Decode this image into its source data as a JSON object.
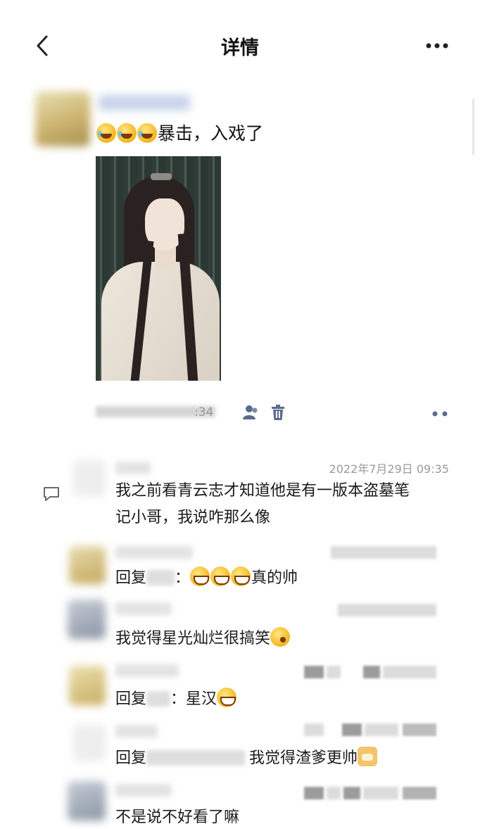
{
  "nav": {
    "title": "详情",
    "back_icon": "chevron-left-icon",
    "more_icon": "more-dots-icon"
  },
  "post": {
    "emojis": [
      "laugh-cry-emoji",
      "laugh-cry-emoji",
      "laugh-cry-emoji"
    ],
    "text": "暴击，入戏了",
    "photo_description": "costume drama character with long hair",
    "time_partial": ":34",
    "icons": [
      "friend-visibility-icon",
      "trash-icon",
      "comment-action-icon"
    ]
  },
  "comments": [
    {
      "time": "2022年7月29日 09:35",
      "line1": "我之前看青云志才知道他是有一版本盗墓笔",
      "line2": "记小哥，我说咋那么像"
    },
    {
      "prefix": "回复",
      "suffix": "：",
      "text": "真的帅",
      "emojis": [
        "grin-emoji",
        "grin-emoji",
        "grin-emoji"
      ]
    },
    {
      "text": "我觉得星光灿烂很搞笑",
      "emoji": "wink-emoji"
    },
    {
      "prefix": "回复",
      "suffix": "：",
      "text": "星汉",
      "emoji": "grin-emoji"
    },
    {
      "prefix": "回复",
      "text": "我觉得渣爹更帅",
      "emoji": "doge-emoji"
    },
    {
      "text": "不是说不好看了嘛"
    }
  ],
  "colors": {
    "text": "#1a1a1a",
    "muted": "#9a9a9a",
    "background": "#ffffff",
    "icon": "#5b6b8c"
  }
}
